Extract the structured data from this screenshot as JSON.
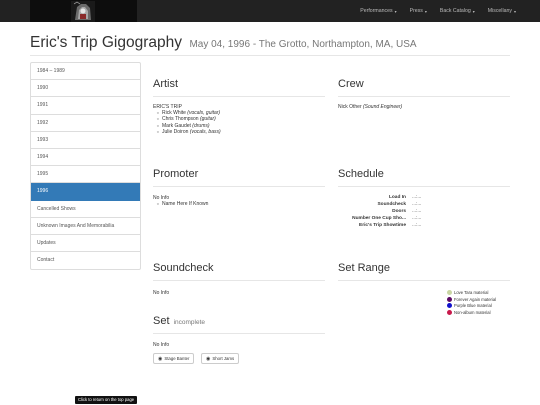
{
  "nav": {
    "items": [
      {
        "label": "Performances",
        "caret": "▾"
      },
      {
        "label": "Press",
        "caret": "▾"
      },
      {
        "label": "Back Catalog",
        "caret": "▾"
      },
      {
        "label": "Miscellany",
        "caret": "▾"
      }
    ]
  },
  "heading": {
    "title": "Eric's Trip Gigography",
    "subtitle": "May 04, 1996 - The Grotto, Northampton, MA, USA"
  },
  "sidebar": {
    "items": [
      {
        "label": "1984 – 1989"
      },
      {
        "label": "1990"
      },
      {
        "label": "1991"
      },
      {
        "label": "1992"
      },
      {
        "label": "1993"
      },
      {
        "label": "1994"
      },
      {
        "label": "1995"
      },
      {
        "label": "1996",
        "active": true
      },
      {
        "label": "Cancelled Shows"
      },
      {
        "label": "Unknown Images And Memorabilia"
      },
      {
        "label": "Updates"
      },
      {
        "label": "Contact"
      }
    ]
  },
  "artist": {
    "title": "Artist",
    "band": "ERIC'S TRIP",
    "members": [
      {
        "name": "Rick White",
        "role": "(vocals, guitar)"
      },
      {
        "name": "Chris Thompson",
        "role": "(guitar)"
      },
      {
        "name": "Mark Gaudet",
        "role": "(drums)"
      },
      {
        "name": "Julie Doiron",
        "role": "(vocals, bass)"
      }
    ]
  },
  "crew": {
    "title": "Crew",
    "name": "Nick Other",
    "role": "(Sound Engineer)"
  },
  "promoter": {
    "title": "Promoter",
    "info": "No Info",
    "item": "Name Here If Known"
  },
  "schedule": {
    "title": "Schedule",
    "rows": [
      {
        "label": "Load In",
        "value": "...:..."
      },
      {
        "label": "Soundcheck",
        "value": "...:..."
      },
      {
        "label": "Doors",
        "value": "...:..."
      },
      {
        "label": "Number One Cup Sho...",
        "value": "...:..."
      },
      {
        "label": "Eric's Trip Showtime",
        "value": "...:..."
      }
    ]
  },
  "soundcheck": {
    "title": "Soundcheck",
    "info": "No Info"
  },
  "setrange": {
    "title": "Set Range",
    "legend": [
      {
        "label": "Love Tara material",
        "color": "#c9d6a3"
      },
      {
        "label": "Forever Again material",
        "color": "#5c0a63"
      },
      {
        "label": "Purple Blue material",
        "color": "#1111cc"
      },
      {
        "label": "Non-album material",
        "color": "#c8194b"
      }
    ]
  },
  "set": {
    "title": "Set",
    "status": "incomplete",
    "info": "No Info",
    "buttons": [
      {
        "label": "Stage Banter"
      },
      {
        "label": "Short Jams"
      }
    ]
  },
  "footer": {
    "top_link": "Click to return on the top page"
  },
  "colors": {
    "navbar": "#222222",
    "active": "#337ab7"
  }
}
